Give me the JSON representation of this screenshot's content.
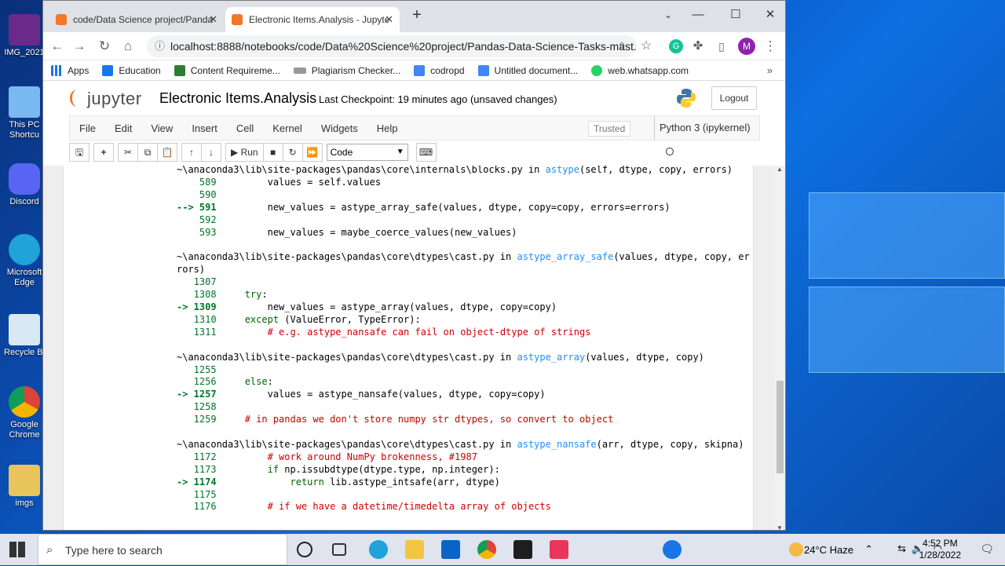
{
  "browser": {
    "tabs": [
      {
        "title": "code/Data Science project/Panda"
      },
      {
        "title": "Electronic Items.Analysis - Jupyte"
      }
    ],
    "url": "localhost:8888/notebooks/code/Data%20Science%20project/Pandas-Data-Science-Tasks-mast...",
    "profile_initial": "M",
    "bookmarks": [
      "Apps",
      "Education",
      "Content Requireme...",
      "Plagiarism Checker...",
      "codropd",
      "Untitled document...",
      "web.whatsapp.com"
    ]
  },
  "jupyter": {
    "logo": "jupyter",
    "title": "Electronic Items.Analysis",
    "checkpoint": "Last Checkpoint: 19 minutes ago  (unsaved changes)",
    "logout": "Logout",
    "menus": [
      "File",
      "Edit",
      "View",
      "Insert",
      "Cell",
      "Kernel",
      "Widgets",
      "Help"
    ],
    "trusted": "Trusted",
    "kernel": "Python 3 (ipykernel)",
    "run_label": "Run",
    "cell_type": "Code"
  },
  "desktop_icons": [
    "IMG_2021",
    "This PC Shortcu",
    "Discord",
    "Microsoft Edge",
    "Recycle Bi",
    "Google Chrome",
    "imgs"
  ],
  "taskbar": {
    "search_placeholder": "Type here to search",
    "weather": "24°C  Haze",
    "time": "4:52 PM",
    "date": "1/28/2022"
  },
  "colors": {
    "jupyter_orange": "#f37726",
    "line_number": "#007427",
    "function_link": "#208ffb"
  }
}
